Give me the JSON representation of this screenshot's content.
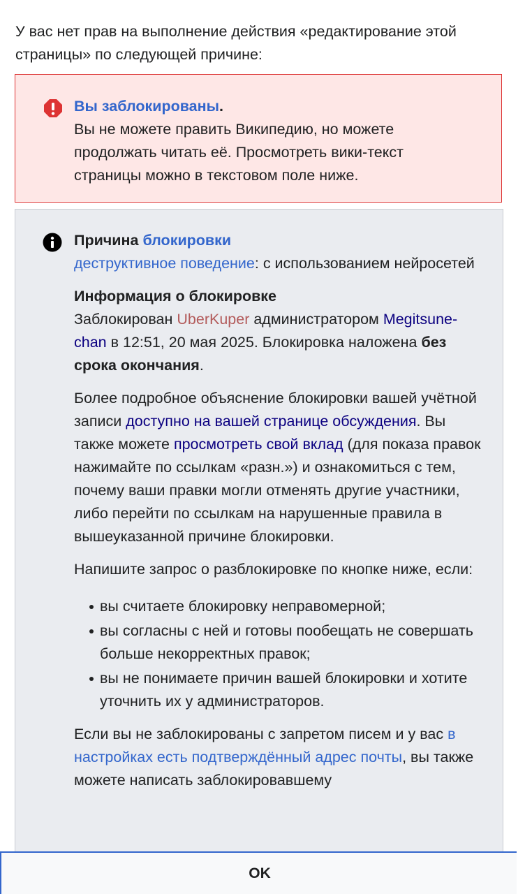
{
  "intro": "У вас нет прав на выполнение действия «редактирование этой страницы» по следующей причине:",
  "error": {
    "icon": "error-exclamation-icon",
    "title_link": "Вы заблокированы",
    "title_suffix": ".",
    "body": "Вы не можете править Википедию, но можете продолжать читать её. Просмотреть вики-текст страницы можно в текстовом поле ниже."
  },
  "info": {
    "icon": "info-icon",
    "reason_label": "Причина",
    "reason_link": "блокировки",
    "reason_value_link": "деструктивное поведение",
    "reason_value_rest": ": с использованием нейросетей",
    "block_info_title": "Информация о блокировке",
    "blocked_prefix": "Заблокирован",
    "blocked_user": "UberKuper",
    "admin_word": "администратором",
    "admin_name": "Megitsune-chan",
    "time_text": "в 12:51, 20 мая 2025. Блокировка наложена",
    "duration": "без срока окончания",
    "duration_suffix": ".",
    "p3_a": "Более подробное объяснение блокировки вашей учётной записи",
    "p3_link1": "доступно на вашей странице обсуждения",
    "p3_b": ". Вы также можете",
    "p3_link2": "просмотреть свой вклад",
    "p3_c": "(для показа правок нажимайте по ссылкам «разн.») и ознакомиться с тем, почему ваши правки могли отменять другие участники, либо перейти по ссылкам на нарушенные правила в вышеуказанной причине блокировки.",
    "p4": "Напишите запрос о разблокировке по кнопке ниже, если:",
    "bullets": [
      "вы считаете блокировку неправомерной;",
      "вы согласны с ней и готовы пообещать не совершать больше некорректных правок;",
      "вы не понимаете причин вашей блокировки и хотите уточнить их у администраторов."
    ],
    "p5_a": "Если вы не заблокированы с запретом писем и у вас",
    "p5_link": "в настройках есть подтверждённый адрес почты",
    "p5_b": ", вы также можете написать заблокировавшему"
  },
  "footer": {
    "ok_label": "OK"
  },
  "colors": {
    "error_bg": "#fee7e6",
    "error_border": "#d33",
    "info_bg": "#eaecf0",
    "link_blue": "#3366cc",
    "link_visited": "#0b0080",
    "link_user": "#b35b5b"
  }
}
